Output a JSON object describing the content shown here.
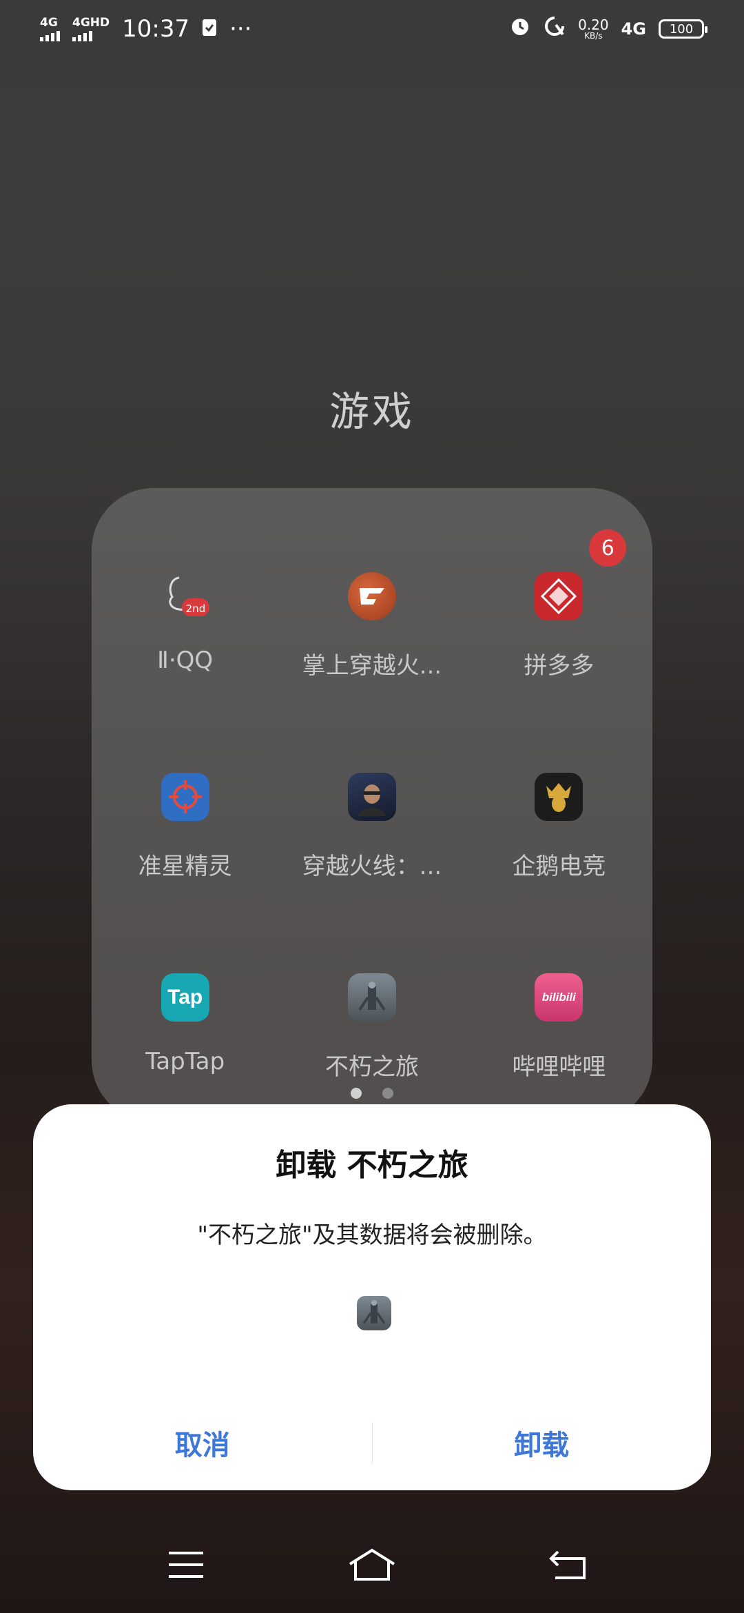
{
  "status_bar": {
    "signal1": "4G",
    "signal2": "4GHD",
    "time": "10:37",
    "more": "···",
    "net_speed_value": "0.20",
    "net_speed_unit": "KB/s",
    "network": "4G",
    "battery": "100"
  },
  "folder": {
    "title": "游戏",
    "apps": [
      {
        "label": "Ⅱ·QQ",
        "icon": "qq-icon",
        "badge": null
      },
      {
        "label": "掌上穿越火...",
        "icon": "crossfire-icon",
        "badge": null
      },
      {
        "label": "拼多多",
        "icon": "pinduoduo-icon",
        "badge": "6"
      },
      {
        "label": "准星精灵",
        "icon": "crosshair-icon",
        "badge": null
      },
      {
        "label": "穿越火线：...",
        "icon": "soldier-icon",
        "badge": null
      },
      {
        "label": "企鹅电竞",
        "icon": "penguin-esports-icon",
        "badge": null
      },
      {
        "label": "TapTap",
        "icon": "taptap-icon",
        "badge": null
      },
      {
        "label": "不朽之旅",
        "icon": "immortal-journey-icon",
        "badge": null
      },
      {
        "label": "哔哩哔哩",
        "icon": "bilibili-icon",
        "badge": null
      }
    ],
    "icon_text": {
      "qq_2nd": "2nd",
      "taptap": "Tap",
      "bilibili": "bilibili"
    }
  },
  "dialog": {
    "title": "卸载 不朽之旅",
    "message": "\"不朽之旅\"及其数据将会被删除。",
    "cancel_label": "取消",
    "uninstall_label": "卸载"
  },
  "colors": {
    "accent": "#3d78d8",
    "badge": "#d9393b"
  }
}
